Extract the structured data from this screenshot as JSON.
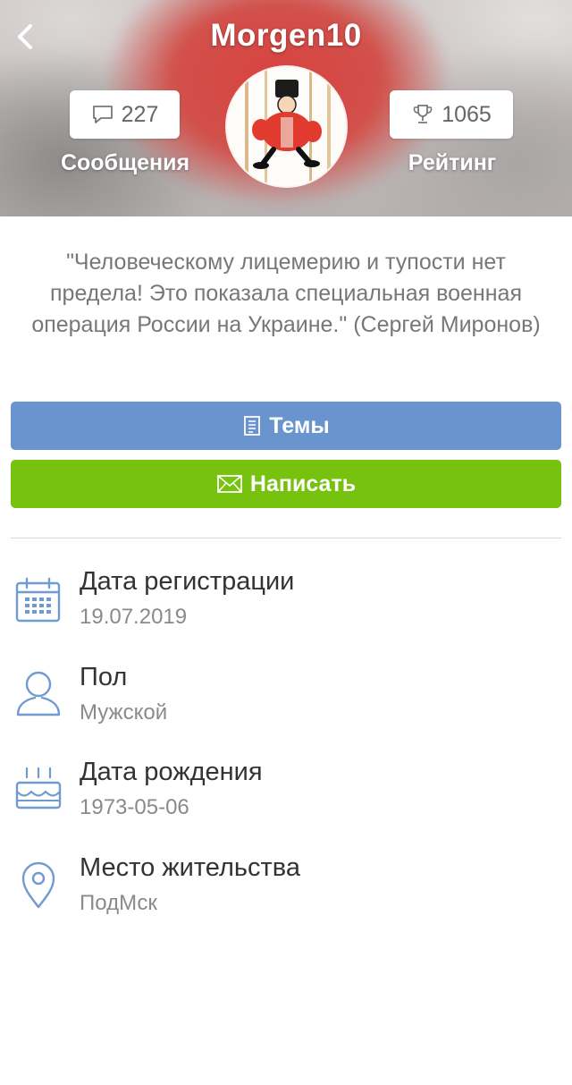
{
  "header": {
    "username": "Morgen10",
    "posts": {
      "count": "227",
      "label": "Сообщения",
      "icon": "comment-icon"
    },
    "rating": {
      "count": "1065",
      "label": "Рейтинг",
      "icon": "trophy-icon"
    }
  },
  "quote": "\"Человеческому лицемерию и тупости нет предела! Это показала специальная военная операция России на Украине.\"  (Сергей Миронов)",
  "buttons": {
    "topics": "Темы",
    "write": "Написать"
  },
  "colors": {
    "topics_button": "#6994cd",
    "write_button": "#76c20e",
    "icon_blue": "#6f9bd0"
  },
  "info": [
    {
      "title": "Дата регистрации",
      "value": "19.07.2019",
      "icon": "calendar-icon"
    },
    {
      "title": "Пол",
      "value": "Мужской",
      "icon": "user-icon"
    },
    {
      "title": "Дата рождения",
      "value": "1973-05-06",
      "icon": "birthday-cake-icon"
    },
    {
      "title": "Место жительства",
      "value": "ПодМск",
      "icon": "location-pin-icon"
    }
  ]
}
